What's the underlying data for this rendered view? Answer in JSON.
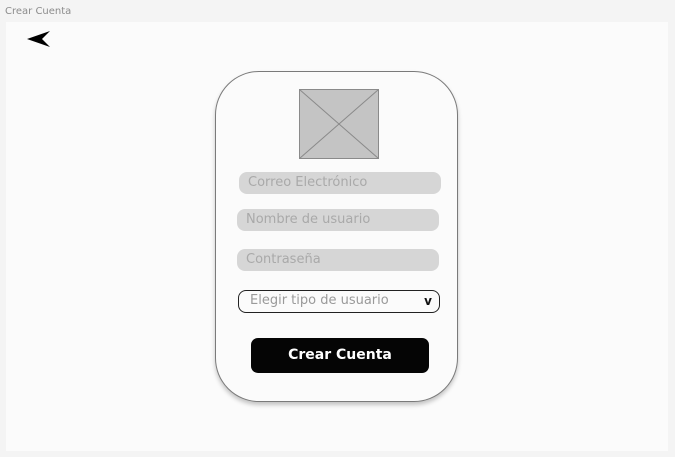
{
  "window": {
    "title": "Crear Cuenta"
  },
  "nav": {
    "back_icon": "back-arrow-icon"
  },
  "form": {
    "logo_icon": "image-placeholder-icon",
    "email_placeholder": "Correo Electrónico",
    "username_placeholder": "Nombre de usuario",
    "password_placeholder": "Contraseña",
    "user_type": {
      "selected": "Elegir tipo de usuario",
      "chevron": "v"
    },
    "submit_label": "Crear Cuenta"
  },
  "colors": {
    "background": "#f4f4f4",
    "canvas": "#fbfbfb",
    "field_fill": "#d6d6d6",
    "placeholder_text": "#a9a9a9",
    "button_fill": "#050505",
    "button_text": "#ffffff"
  }
}
